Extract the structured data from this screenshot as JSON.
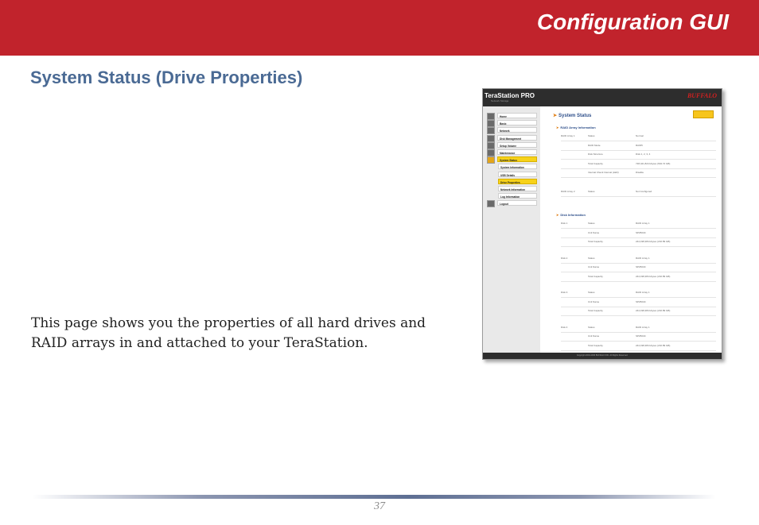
{
  "banner": {
    "title": "Configuration GUI",
    "color": "#c1232c"
  },
  "section": {
    "heading": "System Status (Drive Properties)"
  },
  "body": {
    "text": "This page shows you the properties of all hard drives and RAID arrays in and attached to your TeraStation."
  },
  "page_number": "37",
  "screenshot": {
    "product": "TeraStation PRO",
    "tagline": "Network Storage",
    "logo": "BUFFALO",
    "nav": [
      {
        "label": "Home",
        "sub": false,
        "active": false
      },
      {
        "label": "Basic",
        "sub": false,
        "active": false
      },
      {
        "label": "Network",
        "sub": false,
        "active": false
      },
      {
        "label": "Disk Management",
        "sub": false,
        "active": false
      },
      {
        "label": "Setup Volume",
        "sub": false,
        "active": false
      },
      {
        "label": "Maintenance",
        "sub": false,
        "active": false
      },
      {
        "label": "System Status",
        "sub": false,
        "active": true
      },
      {
        "label": "System Information",
        "sub": true,
        "active": false
      },
      {
        "label": "USB Details",
        "sub": true,
        "active": false
      },
      {
        "label": "Drive Properties",
        "sub": true,
        "active": true
      },
      {
        "label": "Network Information",
        "sub": true,
        "active": false
      },
      {
        "label": "Log Information",
        "sub": true,
        "active": false
      },
      {
        "label": "Logout",
        "sub": false,
        "active": false
      }
    ],
    "main_title": "System Status",
    "raid_title": "RAID Array Information",
    "raid_rows": [
      [
        "RAID Array 1",
        "Status",
        "Normal"
      ],
      [
        "",
        "RAID Mode",
        "RAID5"
      ],
      [
        "",
        "Disk Structure",
        "Disk 1, 2, 3, 4"
      ],
      [
        "",
        "Total Capacity",
        "728,421,824 kbytes (694.72 GB)"
      ],
      [
        "",
        "Internal Check Interval (LED)",
        "Disable"
      ],
      [
        "RAID Array 2",
        "Status",
        "Not Configured"
      ]
    ],
    "disk_title": "Disk Information",
    "disk_rows": [
      [
        "Disk 1",
        "Status",
        "RAID Array 1"
      ],
      [
        "",
        "Unit Name",
        "SP2504C"
      ],
      [
        "",
        "Total Capacity",
        "244,198,384 kbytes (232.89 GB)"
      ],
      [
        "Disk 2",
        "Status",
        "RAID Array 1"
      ],
      [
        "",
        "Unit Name",
        "SP2504C"
      ],
      [
        "",
        "Total Capacity",
        "244,198,384 kbytes (232.89 GB)"
      ],
      [
        "Disk 3",
        "Status",
        "RAID Array 1"
      ],
      [
        "",
        "Unit Name",
        "SP2504C"
      ],
      [
        "",
        "Total Capacity",
        "244,198,384 kbytes (232.89 GB)"
      ],
      [
        "Disk 4",
        "Status",
        "RAID Array 1"
      ],
      [
        "",
        "Unit Name",
        "SP2504C"
      ],
      [
        "",
        "Total Capacity",
        "244,198,384 kbytes (232.89 GB)"
      ]
    ],
    "footer": "Copyright 2004-2006 BUFFALO INC. All Rights Reserved."
  }
}
